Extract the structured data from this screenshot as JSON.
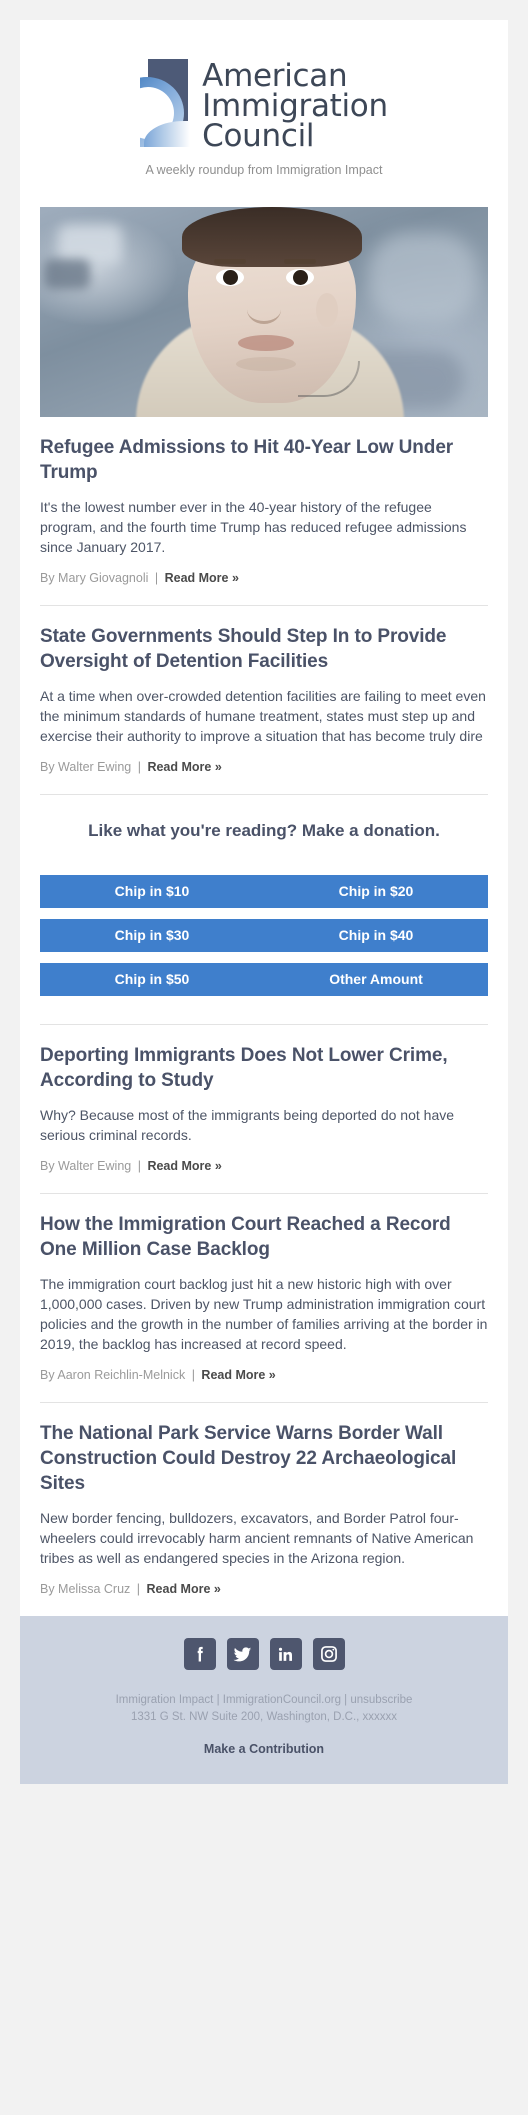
{
  "header": {
    "logo_line1": "American",
    "logo_line2": "Immigration",
    "logo_line3": "Council",
    "logo_alt": "American Immigration Council",
    "tagline": "A weekly roundup from Immigration Impact",
    "hero_alt": "Young refugee boy looking upward"
  },
  "articles": [
    {
      "title": "Refugee Admissions to Hit 40-Year Low Under Trump",
      "summary": "It's the lowest number ever in the 40-year history of the refugee program, and the fourth time Trump has reduced refugee admissions since January 2017.",
      "byline": "By Mary Giovagnoli",
      "separator": "|",
      "read_more": "Read More »",
      "has_image": true
    },
    {
      "title": "State Governments Should Step In to Provide Oversight of Detention Facilities",
      "summary": "At a time when over-crowded detention facilities are failing to meet even the minimum standards of humane treatment, states must step up and exercise their authority to improve a situation that has become truly dire",
      "byline": "By Walter Ewing",
      "separator": "|",
      "read_more": "Read More »",
      "has_image": false
    },
    {
      "title": "Deporting Immigrants Does Not Lower Crime, According to Study",
      "summary": "Why? Because most of the immigrants being deported do not have serious criminal records.",
      "byline": "By Walter Ewing",
      "separator": "|",
      "read_more": "Read More »",
      "has_image": false
    },
    {
      "title": "How the Immigration Court Reached a Record One Million Case Backlog",
      "summary": "The immigration court backlog just hit a new historic high with over 1,000,000 cases. Driven by new Trump administration immigration court policies and the growth in the number of families arriving at the border in 2019, the backlog has increased at record speed.",
      "byline": "By Aaron Reichlin-Melnick",
      "separator": "|",
      "read_more": "Read More »",
      "has_image": false
    },
    {
      "title": "The National Park Service Warns Border Wall Construction Could Destroy 22 Archaeological Sites",
      "summary": "New border fencing, bulldozers, excavators, and Border Patrol four-wheelers could irrevocably harm ancient remnants of Native American tribes as well as endangered species in the Arizona region.",
      "byline": "By Melissa Cruz",
      "separator": "|",
      "read_more": "Read More »",
      "has_image": false
    }
  ],
  "donation": {
    "heading": "Like what you're reading? Make a donation.",
    "button_color": "#3f7fcc",
    "buttons": [
      {
        "label": "Chip in $10",
        "amount": 10
      },
      {
        "label": "Chip in $20",
        "amount": 20
      },
      {
        "label": "Chip in $30",
        "amount": 30
      },
      {
        "label": "Chip in $40",
        "amount": 40
      },
      {
        "label": "Chip in $50",
        "amount": 50
      },
      {
        "label": "Other Amount",
        "amount": null
      }
    ]
  },
  "footer": {
    "background_color": "#ccd3e0",
    "icon_color": "#4e566e",
    "social": [
      {
        "name": "facebook-icon",
        "label": "Facebook"
      },
      {
        "name": "twitter-icon",
        "label": "Twitter"
      },
      {
        "name": "linkedin-icon",
        "label": "LinkedIn"
      },
      {
        "name": "instagram-icon",
        "label": "Instagram"
      }
    ],
    "line1": "Immigration Impact | ImmigrationCouncil.org | unsubscribe",
    "line2": "1331 G St. NW Suite 200, Washington, D.C., xxxxxx",
    "cta": "Make a Contribution"
  },
  "theme": {
    "page_background": "#f2f2f2",
    "body_background": "#ffffff",
    "heading_color": "#4a5268",
    "text_color": "#4d5566",
    "muted_color": "#9a9a9a"
  }
}
